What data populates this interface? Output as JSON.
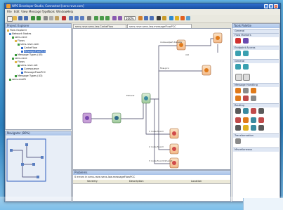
{
  "window": {
    "title": "WPS Developer Studio, Connected [sens-rave.com]",
    "minimize": "_",
    "maximize": "□",
    "close": "x"
  },
  "menu": [
    "File",
    "Edit",
    "View",
    "Message Type",
    "Tools",
    "Window",
    "Help"
  ],
  "toolbar": {
    "zoom": "100%"
  },
  "project_panel": {
    "title": "Project Explorer",
    "tree": [
      {
        "label": "Flow Explorer",
        "selected": false
      },
      {
        "label": "Network Nodes",
        "selected": false
      },
      {
        "label": "sens-rave",
        "selected": false
      },
      {
        "label": "Flows",
        "selected": false
      },
      {
        "label": "sens-rave.com",
        "selected": false
      },
      {
        "label": "CarbeFlow",
        "selected": false
      },
      {
        "label": "MessageFlowPCC",
        "selected": true
      },
      {
        "label": "Message Types (45)",
        "selected": false
      },
      {
        "label": "sens-rave",
        "selected": false
      },
      {
        "label": "Flows",
        "selected": false
      },
      {
        "label": "sens-rave.net",
        "selected": false
      },
      {
        "label": "Coresqueue",
        "selected": false
      },
      {
        "label": "MessageFlowPCC",
        "selected": false
      },
      {
        "label": "Message Types (43)",
        "selected": false
      },
      {
        "label": "sens-enefit",
        "selected": false
      }
    ]
  },
  "navigator_panel": {
    "title": "Navigator (80%)"
  },
  "tabs": [
    {
      "label": "sens-rave.sens-law.CarbeFlow",
      "active": false
    },
    {
      "label": "sens-rave.sens-law.messageFlowPCC",
      "active": true
    }
  ],
  "canvas_labels": {
    "top_route": "route-expert-transfer",
    "mid_a": "flow-pco",
    "mid_b": "Failover",
    "mid_c": "init",
    "low_a": "1 route-found",
    "low_b": "2 route-found",
    "low_c": "3 route-found-timeout"
  },
  "problems_panel": {
    "title": "Problems",
    "summary": "0 errors in sens-rave.sens-law.messageFlowPCC",
    "columns": [
      "Severity",
      "Description",
      "Location"
    ]
  },
  "palette": {
    "title": "Tools Palette",
    "sections": [
      "General",
      "Flow Markers",
      "Endpoint Access",
      "General",
      "Message Handling",
      "Routing",
      "Transformation",
      "Miscellaneous"
    ]
  }
}
